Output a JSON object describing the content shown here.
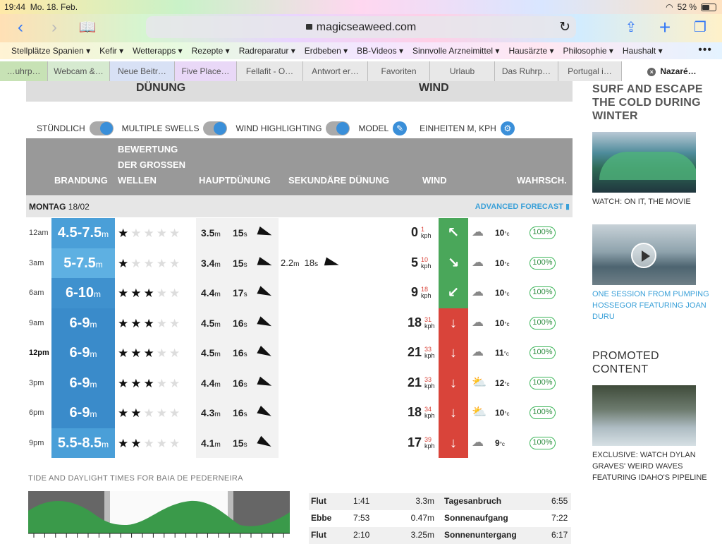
{
  "status": {
    "time": "19:44",
    "date": "Mo. 18. Feb.",
    "battery": "52 %",
    "battery_level": 0.52
  },
  "browser": {
    "url": "magicseaweed.com",
    "bookmarks": [
      "Stellplätze Spanien ▾",
      "Kefir ▾",
      "Wetterapps ▾",
      "Rezepte ▾",
      "Radreparatur ▾",
      "Erdbeben ▾",
      "BB-Videos ▾",
      "Sinnvolle Arzneimittel ▾",
      "Hausärzte ▾",
      "Philosophie ▾",
      "Haushalt ▾"
    ],
    "tabs": [
      "…uhrp…",
      "Webcam &…",
      "Neue Beitr…",
      "Five Place…",
      "Fellafit - O…",
      "Antwort er…",
      "Favoriten",
      "Urlaub",
      "Das Ruhrp…",
      "Portugal i…",
      "Nazaré…"
    ]
  },
  "topbar": {
    "left": "DÜNUNG",
    "right": "WIND"
  },
  "toggles": {
    "hourly": "STÜNDLICH",
    "multiple": "MULTIPLE SWELLS",
    "wind": "WIND HIGHLIGHTING",
    "model": "MODEL",
    "units": "EINHEITEN M, KPH"
  },
  "thead": {
    "surf": "BRANDUNG",
    "rating": "BEWERTUNG DER GROSSEN WELLEN",
    "primary": "HAUPTDÜNUNG",
    "secondary": "SEKUNDÄRE DÜNUNG",
    "wind": "WIND",
    "prob": "WAHRSCH."
  },
  "day": {
    "label": "MONTAG",
    "date": "18/02",
    "advanced": "ADVANCED FORECAST"
  },
  "rows": [
    {
      "time": "12am",
      "bold": false,
      "surf": "4.5-7.5",
      "stars": 1,
      "ph": "3.5",
      "pp": "15",
      "sh": "",
      "sp": "",
      "wind": "0",
      "gust": "1",
      "dir": "↖",
      "dircolor": "#4aa75a",
      "weather": "☁",
      "temp": "10",
      "prob": "100%"
    },
    {
      "time": "3am",
      "bold": false,
      "surf": "5-7.5",
      "stars": 1,
      "ph": "3.4",
      "pp": "15",
      "sh": "2.2",
      "sp": "18",
      "wind": "5",
      "gust": "10",
      "dir": "↘",
      "dircolor": "#4aa75a",
      "weather": "☁",
      "temp": "10",
      "prob": "100%"
    },
    {
      "time": "6am",
      "bold": false,
      "surf": "6-10",
      "stars": 3,
      "ph": "4.4",
      "pp": "17",
      "sh": "",
      "sp": "",
      "wind": "9",
      "gust": "18",
      "dir": "↙",
      "dircolor": "#4aa75a",
      "weather": "☁",
      "temp": "10",
      "prob": "100%"
    },
    {
      "time": "9am",
      "bold": false,
      "surf": "6-9",
      "stars": 3,
      "ph": "4.5",
      "pp": "16",
      "sh": "",
      "sp": "",
      "wind": "18",
      "gust": "31",
      "dir": "↓",
      "dircolor": "#d9443a",
      "weather": "☁",
      "temp": "10",
      "prob": "100%"
    },
    {
      "time": "12pm",
      "bold": true,
      "surf": "6-9",
      "stars": 3,
      "ph": "4.5",
      "pp": "16",
      "sh": "",
      "sp": "",
      "wind": "21",
      "gust": "33",
      "dir": "↓",
      "dircolor": "#d9443a",
      "weather": "☁",
      "temp": "11",
      "prob": "100%"
    },
    {
      "time": "3pm",
      "bold": false,
      "surf": "6-9",
      "stars": 3,
      "ph": "4.4",
      "pp": "16",
      "sh": "",
      "sp": "",
      "wind": "21",
      "gust": "33",
      "dir": "↓",
      "dircolor": "#d9443a",
      "weather": "⛅",
      "temp": "12",
      "prob": "100%"
    },
    {
      "time": "6pm",
      "bold": false,
      "surf": "6-9",
      "stars": 2,
      "ph": "4.3",
      "pp": "16",
      "sh": "",
      "sp": "",
      "wind": "18",
      "gust": "34",
      "dir": "↓",
      "dircolor": "#d9443a",
      "weather": "⛅",
      "temp": "10",
      "prob": "100%"
    },
    {
      "time": "9pm",
      "bold": false,
      "surf": "5.5-8.5",
      "stars": 2,
      "ph": "4.1",
      "pp": "15",
      "sh": "",
      "sp": "",
      "wind": "17",
      "gust": "39",
      "dir": "↓",
      "dircolor": "#d9443a",
      "weather": "☁",
      "temp": "9",
      "prob": "100%"
    }
  ],
  "units": {
    "m": "m",
    "s": "s",
    "kph": "kph",
    "deg": "°c"
  },
  "tide": {
    "title": "TIDE AND DAYLIGHT TIMES FOR BAIA DE PEDERNEIRA",
    "table": [
      {
        "type": "Flut",
        "time": "1:41",
        "height": "3.3m",
        "dlabel": "Tagesanbruch",
        "dtime": "6:55"
      },
      {
        "type": "Ebbe",
        "time": "7:53",
        "height": "0.47m",
        "dlabel": "Sonnenaufgang",
        "dtime": "7:22"
      },
      {
        "type": "Flut",
        "time": "2:10",
        "height": "3.25m",
        "dlabel": "Sonnenuntergang",
        "dtime": "6:17"
      }
    ]
  },
  "sidebar": {
    "heading1": "SURF AND ESCAPE THE COLD DURING WINTER",
    "cap1": "WATCH: ON IT, THE MOVIE",
    "cap2": "ONE SESSION FROM PUMPING HOSSEGOR FEATURING JOAN DURU",
    "heading2": "PROMOTED CONTENT",
    "cap3": "EXCLUSIVE: WATCH DYLAN GRAVES' WEIRD WAVES FEATURING IDAHO'S PIPELINE"
  }
}
